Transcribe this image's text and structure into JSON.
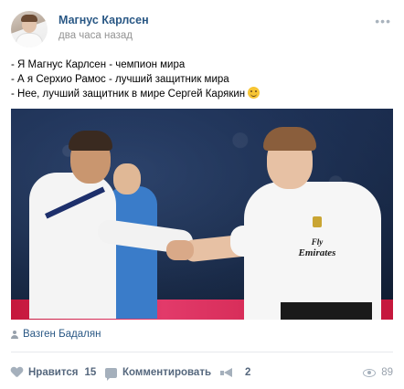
{
  "post": {
    "author": "Магнус Карлсен",
    "time": "два часа назад",
    "more_icon": "more-horizontal-icon",
    "text_lines": [
      "- Я Магнус Карлсен - чемпион мира",
      "- А я Серхио Рамос - лучший защитник мира",
      "- Нее, лучший защитник в мире Сергей Карякин"
    ],
    "emoji": "laughing-emoji-icon",
    "photo": {
      "sponsor_top": "Fly",
      "sponsor_bottom": "Emirates"
    },
    "signer": "Вазген Бадалян"
  },
  "actions": {
    "like_label": "Нравится",
    "like_count": "15",
    "comment_label": "Комментировать",
    "share_count": "2",
    "views_count": "89"
  },
  "colors": {
    "link": "#2a5885",
    "muted": "#939393",
    "action": "#55677d",
    "icon": "#a5b0bc"
  }
}
